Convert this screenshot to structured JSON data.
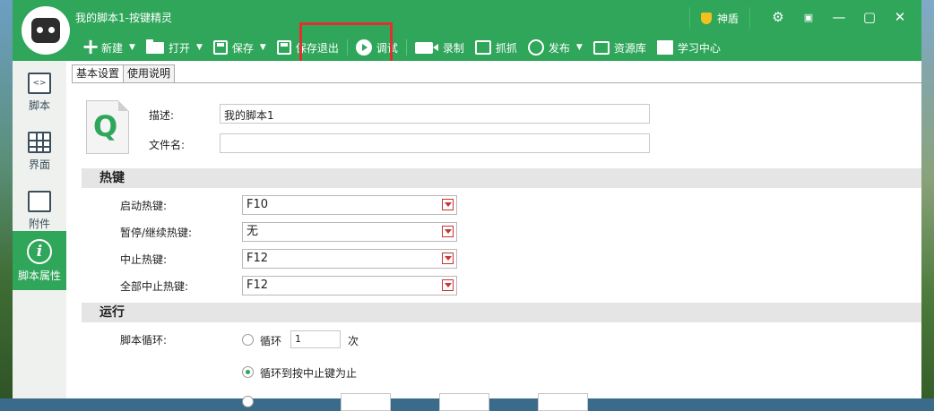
{
  "window": {
    "title": "我的脚本1-按键精灵",
    "shield_label": "神盾",
    "controls": [
      "⚙",
      "▣",
      "—",
      "▢",
      "✕"
    ]
  },
  "toolbar": {
    "new": "新建",
    "open": "打开",
    "save": "保存",
    "save_exit": "保存退出",
    "debug": "调试",
    "record": "录制",
    "grab": "抓抓",
    "publish": "发布",
    "resources": "资源库",
    "learn": "学习中心"
  },
  "sidebar": {
    "items": [
      {
        "label": "脚本",
        "icon": "code-icon"
      },
      {
        "label": "界面",
        "icon": "grid-icon"
      },
      {
        "label": "附件",
        "icon": "attachment-icon"
      },
      {
        "label": "脚本属性",
        "icon": "info-icon"
      }
    ],
    "active_index": 3
  },
  "tabs": [
    "基本设置",
    "使用说明"
  ],
  "basic": {
    "desc_label": "描述:",
    "desc_value": "我的脚本1",
    "filename_label": "文件名:",
    "filename_value": "",
    "file_icon_letter": "Q"
  },
  "hotkeys": {
    "section_title": "热键",
    "rows": [
      {
        "label": "启动热键:",
        "value": "F10"
      },
      {
        "label": "暂停/继续热键:",
        "value": "无"
      },
      {
        "label": "中止热键:",
        "value": "F12"
      },
      {
        "label": "全部中止热键:",
        "value": "F12"
      }
    ]
  },
  "run": {
    "section_title": "运行",
    "loop_label": "脚本循环:",
    "option_loop": "循环",
    "loop_count": "1",
    "loop_unit": "次",
    "option_until_stop": "循环到按中止键为止",
    "selected": "until_stop"
  },
  "colors": {
    "brand_green": "#2fa65a",
    "highlight_red": "#e3302f"
  }
}
